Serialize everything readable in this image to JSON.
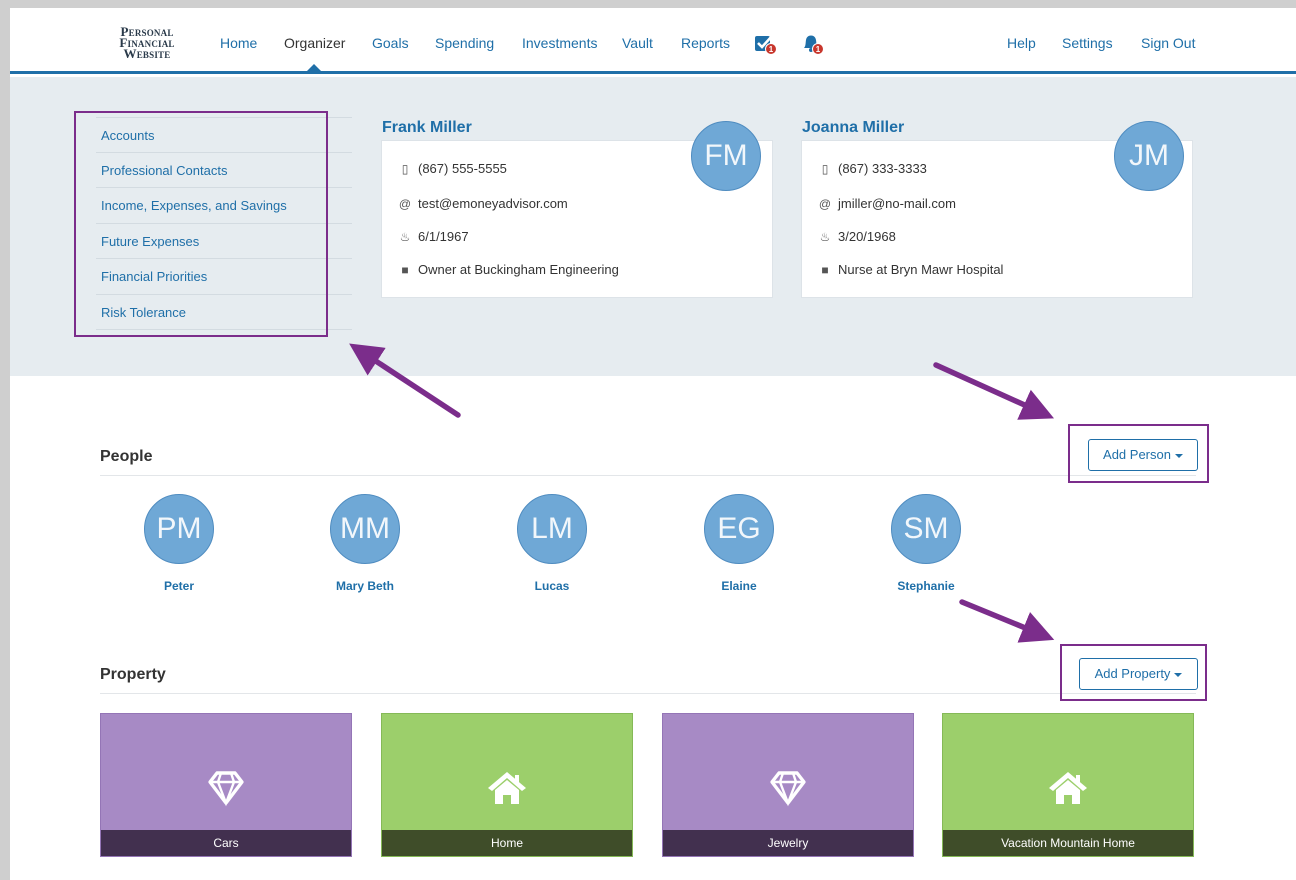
{
  "app": {
    "logo_line1": "Personal",
    "logo_line2": "Financial",
    "logo_line3": "Website"
  },
  "nav": {
    "home": "Home",
    "organizer": "Organizer",
    "goals": "Goals",
    "spending": "Spending",
    "investments": "Investments",
    "vault": "Vault",
    "reports": "Reports",
    "tasks_badge": "1",
    "alerts_badge": "1",
    "help": "Help",
    "settings": "Settings",
    "signout": "Sign Out"
  },
  "sidebar": {
    "items": [
      {
        "label": "Accounts"
      },
      {
        "label": "Professional Contacts"
      },
      {
        "label": "Income, Expenses, and Savings"
      },
      {
        "label": "Future Expenses"
      },
      {
        "label": "Financial Priorities"
      },
      {
        "label": "Risk Tolerance"
      }
    ]
  },
  "clients": [
    {
      "name": "Frank Miller",
      "initials": "FM",
      "phone": "(867) 555-5555",
      "email": "test@emoneyadvisor.com",
      "birthdate": "6/1/1967",
      "occupation": "Owner at Buckingham Engineering"
    },
    {
      "name": "Joanna Miller",
      "initials": "JM",
      "phone": "(867) 333-3333",
      "email": "jmiller@no-mail.com",
      "birthdate": "3/20/1968",
      "occupation": "Nurse at Bryn Mawr Hospital"
    }
  ],
  "people": {
    "title": "People",
    "add_button": "Add Person",
    "members": [
      {
        "initials": "PM",
        "name": "Peter"
      },
      {
        "initials": "MM",
        "name": "Mary Beth"
      },
      {
        "initials": "LM",
        "name": "Lucas"
      },
      {
        "initials": "EG",
        "name": "Elaine"
      },
      {
        "initials": "SM",
        "name": "Stephanie"
      }
    ]
  },
  "property": {
    "title": "Property",
    "add_button": "Add Property",
    "items": [
      {
        "label": "Cars",
        "icon": "diamond-icon",
        "color": "#a78ac5"
      },
      {
        "label": "Home",
        "icon": "house-icon",
        "color": "#9ccf6b"
      },
      {
        "label": "Jewelry",
        "icon": "diamond-icon",
        "color": "#a78ac5"
      },
      {
        "label": "Vacation Mountain Home",
        "icon": "house-icon",
        "color": "#9ccf6b"
      }
    ]
  },
  "colors": {
    "brand": "#1f6fa8",
    "annotation": "#7b2d8b",
    "hero_bg": "#e6ecf0",
    "avatar": "#6fa8d6"
  }
}
